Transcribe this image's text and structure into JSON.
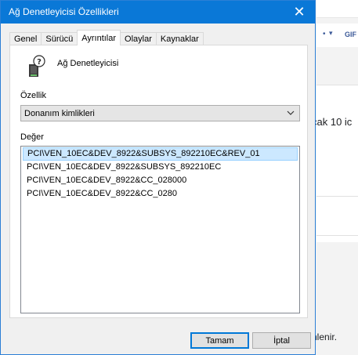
{
  "dialog": {
    "title": "Ağ Denetleyicisi Özellikleri",
    "close_glyph": "✕",
    "tabs": [
      {
        "label": "Genel",
        "active": false
      },
      {
        "label": "Sürücü",
        "active": false
      },
      {
        "label": "Ayrıntılar",
        "active": true
      },
      {
        "label": "Olaylar",
        "active": false
      },
      {
        "label": "Kaynaklar",
        "active": false
      }
    ],
    "device_name": "Ağ Denetleyicisi",
    "property_label": "Özellik",
    "property_selected": "Donanım kimlikleri",
    "value_label": "Değer",
    "values": [
      "PCI\\VEN_10EC&DEV_8922&SUBSYS_892210EC&REV_01",
      "PCI\\VEN_10EC&DEV_8922&SUBSYS_892210EC",
      "PCI\\VEN_10EC&DEV_8922&CC_028000",
      "PCI\\VEN_10EC&DEV_8922&CC_0280"
    ],
    "ok_label": "Tamam",
    "cancel_label": "İptal"
  },
  "background": {
    "toolbar_gif": "GIF",
    "text1": "cak 10 ic",
    "text2": "nlenir."
  },
  "colors": {
    "titlebar": "#0a78d7",
    "selection": "#cce8ff",
    "accent": "#0078d7"
  }
}
